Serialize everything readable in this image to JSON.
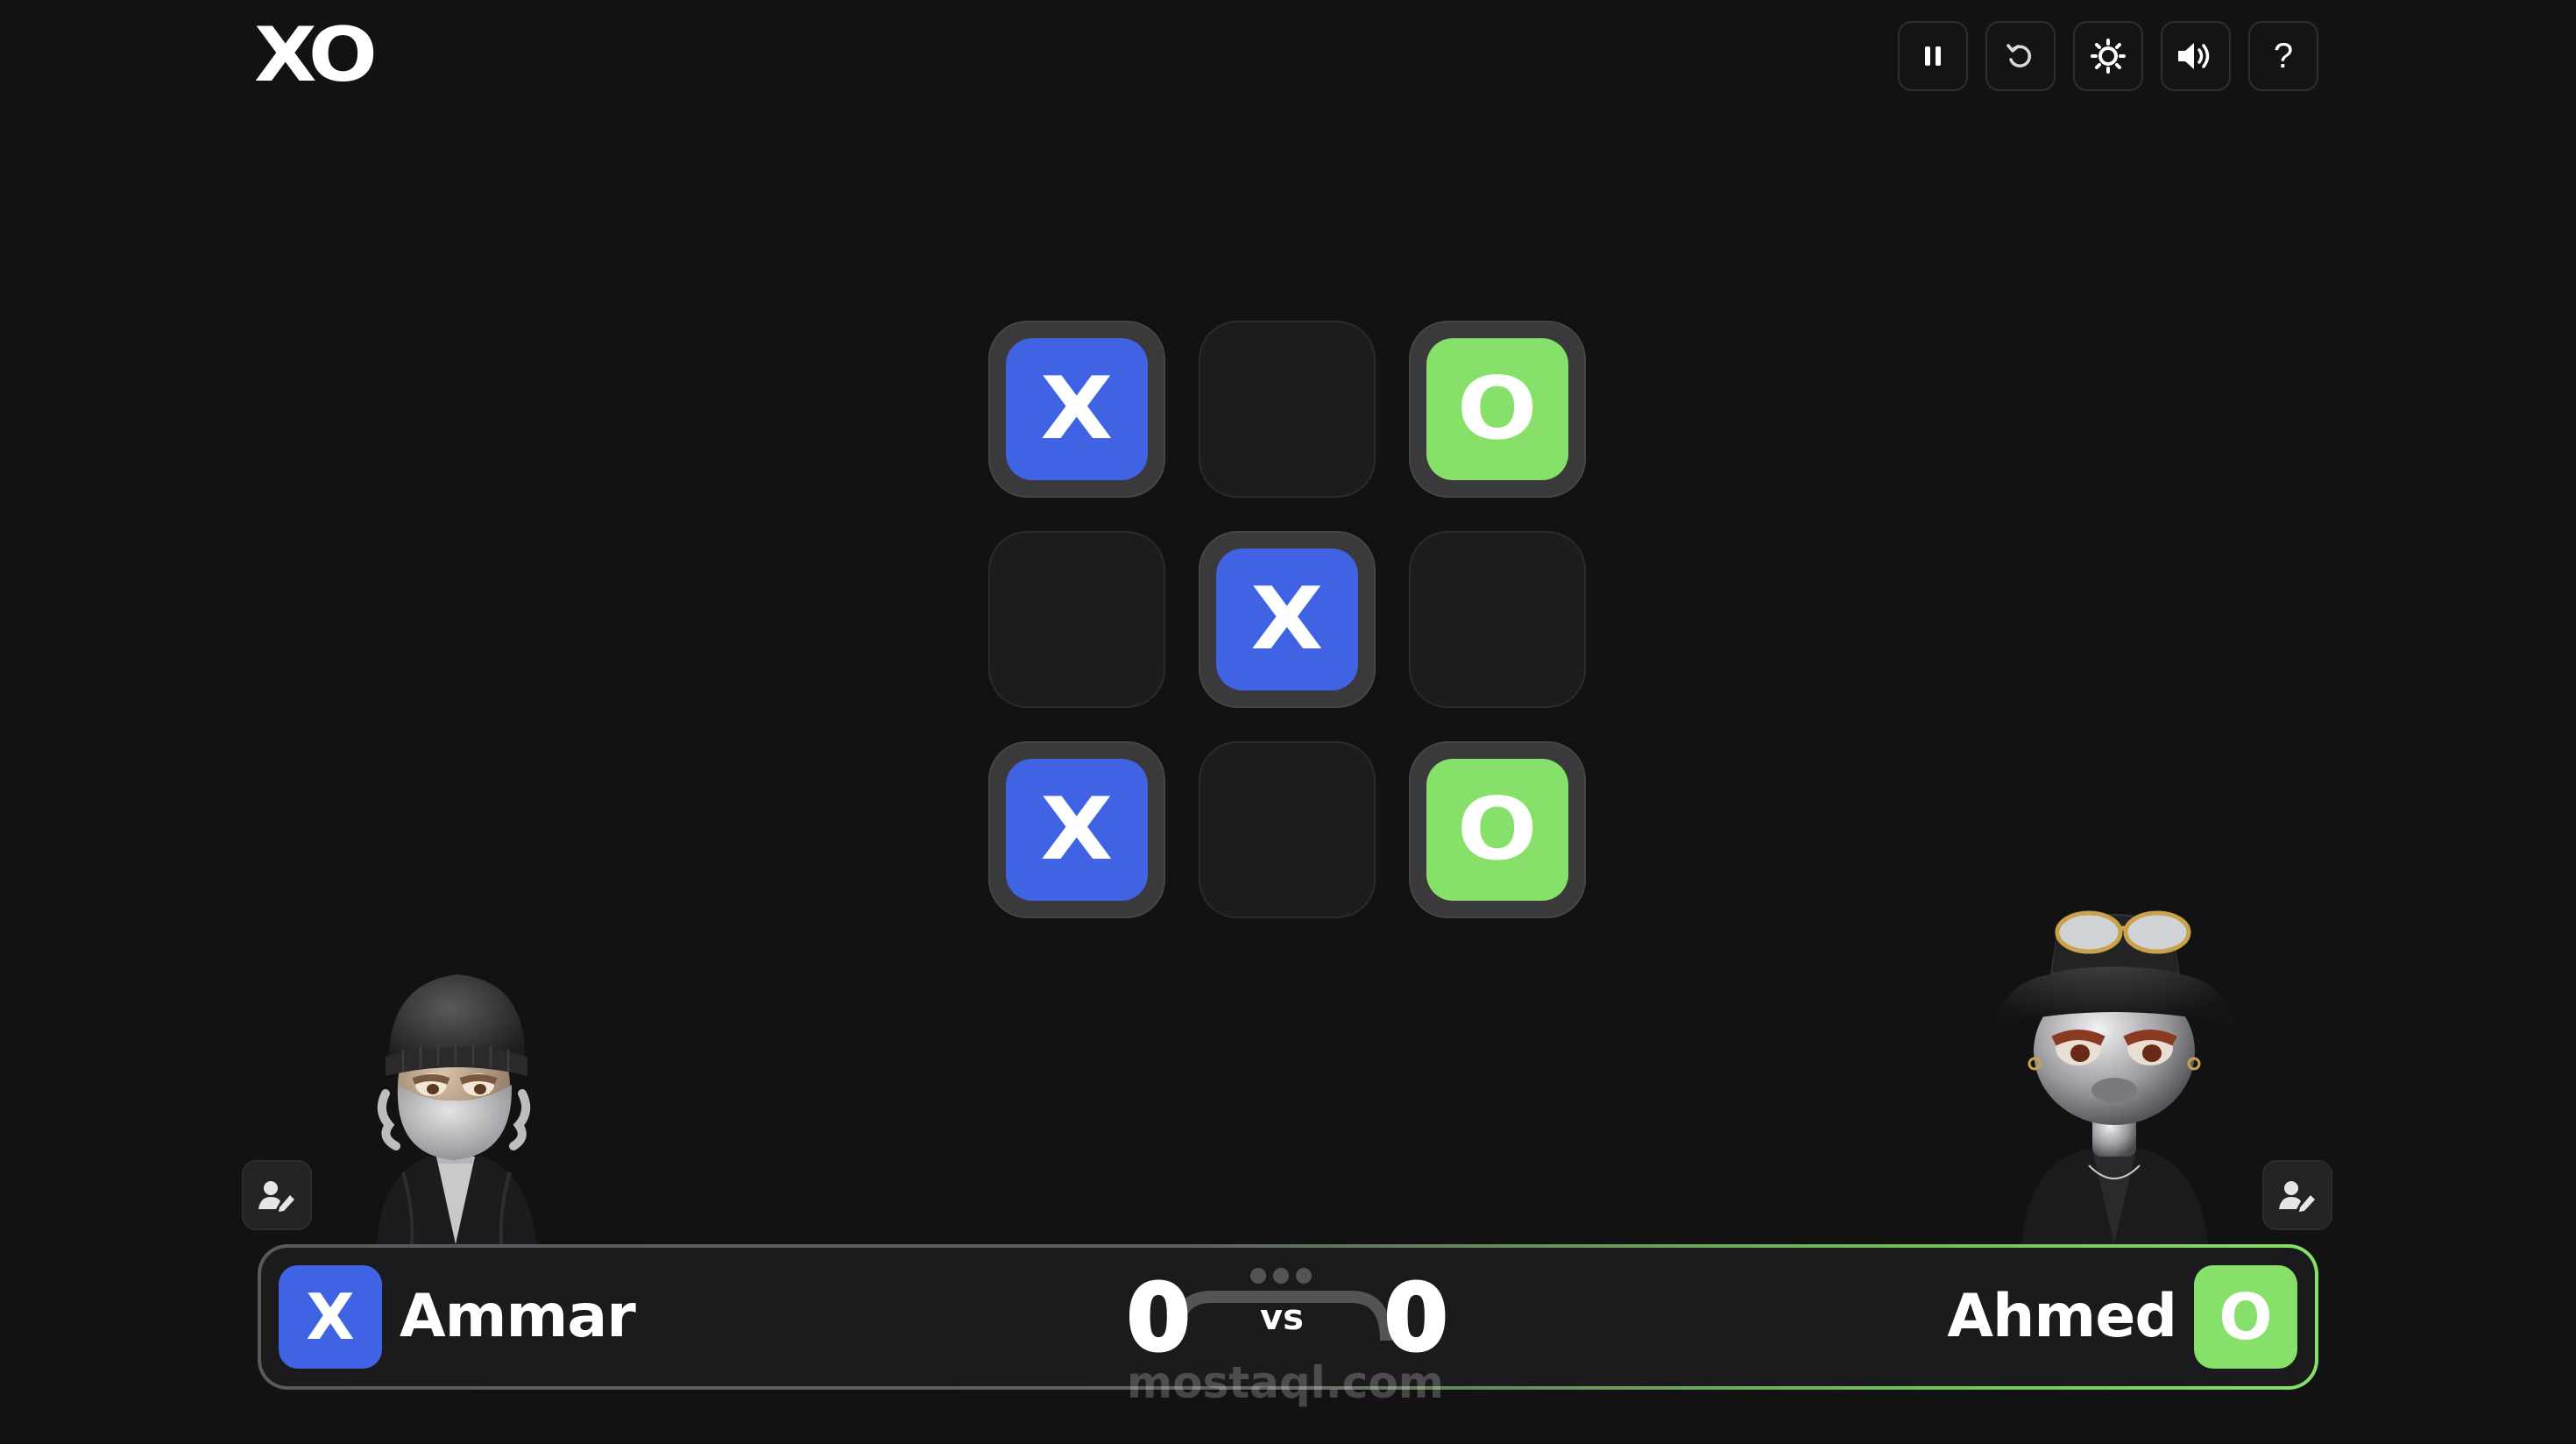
{
  "app": {
    "logo": "XO"
  },
  "toolbar": {
    "buttons": [
      {
        "name": "pause-button",
        "icon": "pause-icon"
      },
      {
        "name": "restart-button",
        "icon": "undo-icon"
      },
      {
        "name": "theme-button",
        "icon": "sun-icon"
      },
      {
        "name": "sound-button",
        "icon": "speaker-icon"
      },
      {
        "name": "help-button",
        "icon": "question-icon",
        "label": "?"
      }
    ]
  },
  "board": {
    "cells": [
      "X",
      "",
      "O",
      "",
      "X",
      "",
      "X",
      "",
      "O"
    ]
  },
  "players": {
    "left": {
      "name": "Ammar",
      "mark": "X",
      "score": "0",
      "color": "#3f63e2"
    },
    "right": {
      "name": "Ahmed",
      "mark": "O",
      "score": "0",
      "color": "#86e06a"
    }
  },
  "scorebar": {
    "vs_label": "vs"
  },
  "watermark": {
    "text": "mostaql.com"
  },
  "colors": {
    "background": "#121213",
    "x_tile": "#3f63e2",
    "o_tile": "#86e06a",
    "cell_empty": "#1c1c1e",
    "cell_filled": "#3a3a3c"
  }
}
